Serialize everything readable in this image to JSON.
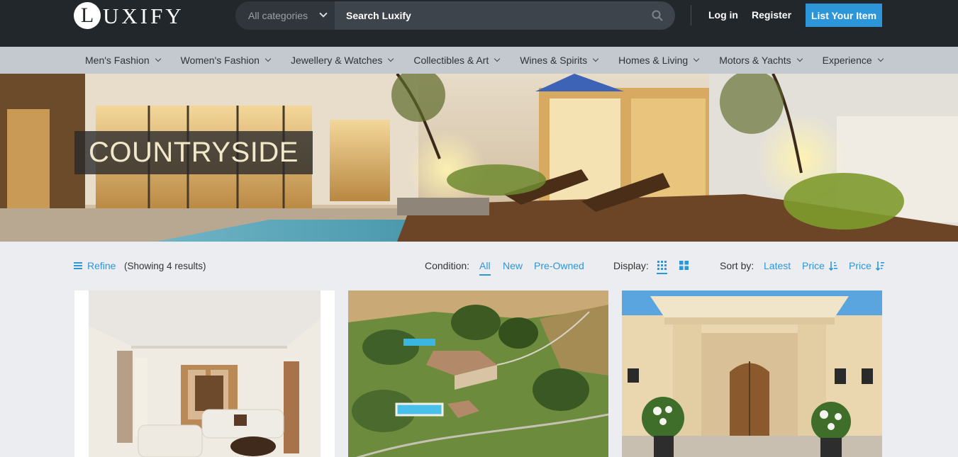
{
  "header": {
    "logo_letter": "L",
    "logo_rest": "UXIFY",
    "search": {
      "category": "All categories",
      "placeholder": "Search Luxify"
    },
    "login": "Log in",
    "register": "Register",
    "list_item": "List Your Item"
  },
  "categories": [
    "Men's Fashion",
    "Women's Fashion",
    "Jewellery & Watches",
    "Collectibles & Art",
    "Wines & Spirits",
    "Homes & Living",
    "Motors & Yachts",
    "Experience"
  ],
  "hero": {
    "title": "COUNTRYSIDE"
  },
  "toolbar": {
    "refine": "Refine",
    "showing": "(Showing 4 results)",
    "condition_label": "Condition:",
    "condition_options": [
      "All",
      "New",
      "Pre-Owned"
    ],
    "condition_selected": "All",
    "display_label": "Display:",
    "sort_label": "Sort by:",
    "sort_options": [
      "Latest",
      "Price",
      "Price"
    ]
  },
  "colors": {
    "accent": "#2d96d8",
    "topbar": "#22272c",
    "catnav": "#c4c9cf",
    "page_bg": "#ecedf0",
    "hero_title": "#f1e7c9"
  },
  "icons": {
    "search": "search-icon",
    "refine": "hamburger-icon",
    "grid_view": "grid-view-icon",
    "list_view": "large-grid-view-icon",
    "sort_asc": "sort-ascending-icon",
    "sort_desc": "sort-descending-icon"
  },
  "listings": [
    {
      "image": "living-room-interior"
    },
    {
      "image": "aerial-country-estate"
    },
    {
      "image": "villa-entrance"
    }
  ]
}
